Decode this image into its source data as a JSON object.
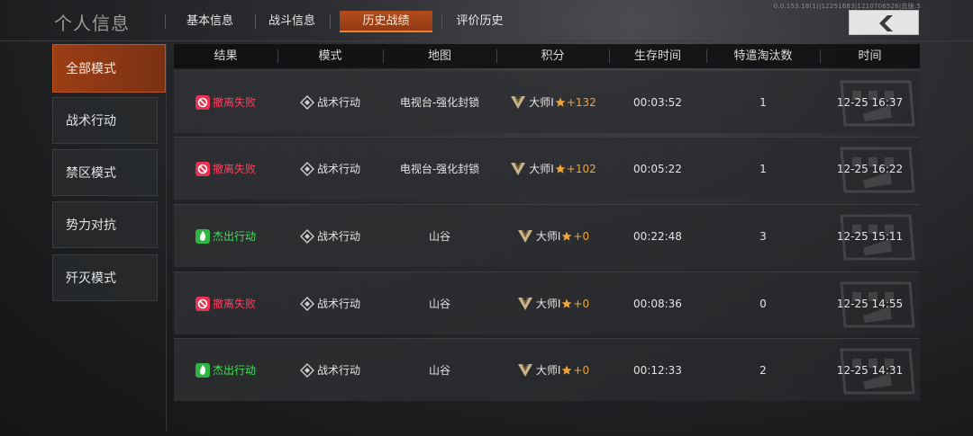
{
  "header": {
    "title": "个人信息",
    "version": "0.0.153.18(1)|12251683|1210706526|总版:5"
  },
  "tabs": [
    {
      "label": "基本信息",
      "active": false
    },
    {
      "label": "战斗信息",
      "active": false
    },
    {
      "label": "历史战绩",
      "active": true
    },
    {
      "label": "评价历史",
      "active": false
    }
  ],
  "sidebar": {
    "items": [
      {
        "label": "全部模式",
        "active": true
      },
      {
        "label": "战术行动",
        "active": false
      },
      {
        "label": "禁区模式",
        "active": false
      },
      {
        "label": "势力对抗",
        "active": false
      },
      {
        "label": "歼灭模式",
        "active": false
      }
    ]
  },
  "table": {
    "columns": [
      "结果",
      "模式",
      "地图",
      "积分",
      "生存时间",
      "特遣淘汰数",
      "时间"
    ],
    "rows": [
      {
        "result": "撤离失败",
        "result_type": "fail",
        "mode": "战术行动",
        "map": "电视台-强化封锁",
        "rank": "大师I",
        "points": "+132",
        "survival": "00:03:52",
        "kills": "1",
        "time": "12-25 16:37"
      },
      {
        "result": "撤离失败",
        "result_type": "fail",
        "mode": "战术行动",
        "map": "电视台-强化封锁",
        "rank": "大师I",
        "points": "+102",
        "survival": "00:05:22",
        "kills": "1",
        "time": "12-25 16:22"
      },
      {
        "result": "杰出行动",
        "result_type": "win",
        "mode": "战术行动",
        "map": "山谷",
        "rank": "大师I",
        "points": "+0",
        "survival": "00:22:48",
        "kills": "3",
        "time": "12-25 15:11"
      },
      {
        "result": "撤离失败",
        "result_type": "fail",
        "mode": "战术行动",
        "map": "山谷",
        "rank": "大师I",
        "points": "+0",
        "survival": "00:08:36",
        "kills": "0",
        "time": "12-25 14:55"
      },
      {
        "result": "杰出行动",
        "result_type": "win",
        "mode": "战术行动",
        "map": "山谷",
        "rank": "大师I",
        "points": "+0",
        "survival": "00:12:33",
        "kills": "2",
        "time": "12-25 14:31"
      }
    ]
  },
  "icons": {
    "back": "back-arrow-icon",
    "fail": "extraction-fail-icon",
    "win": "outstanding-action-icon",
    "mode": "operation-diamond-icon",
    "rank": "master-rank-badge-icon",
    "points": "star-points-icon"
  },
  "colors": {
    "accent": "#c0551f",
    "fail": "#ff3f5f",
    "win": "#3fe356",
    "points": "#f0a43a"
  }
}
